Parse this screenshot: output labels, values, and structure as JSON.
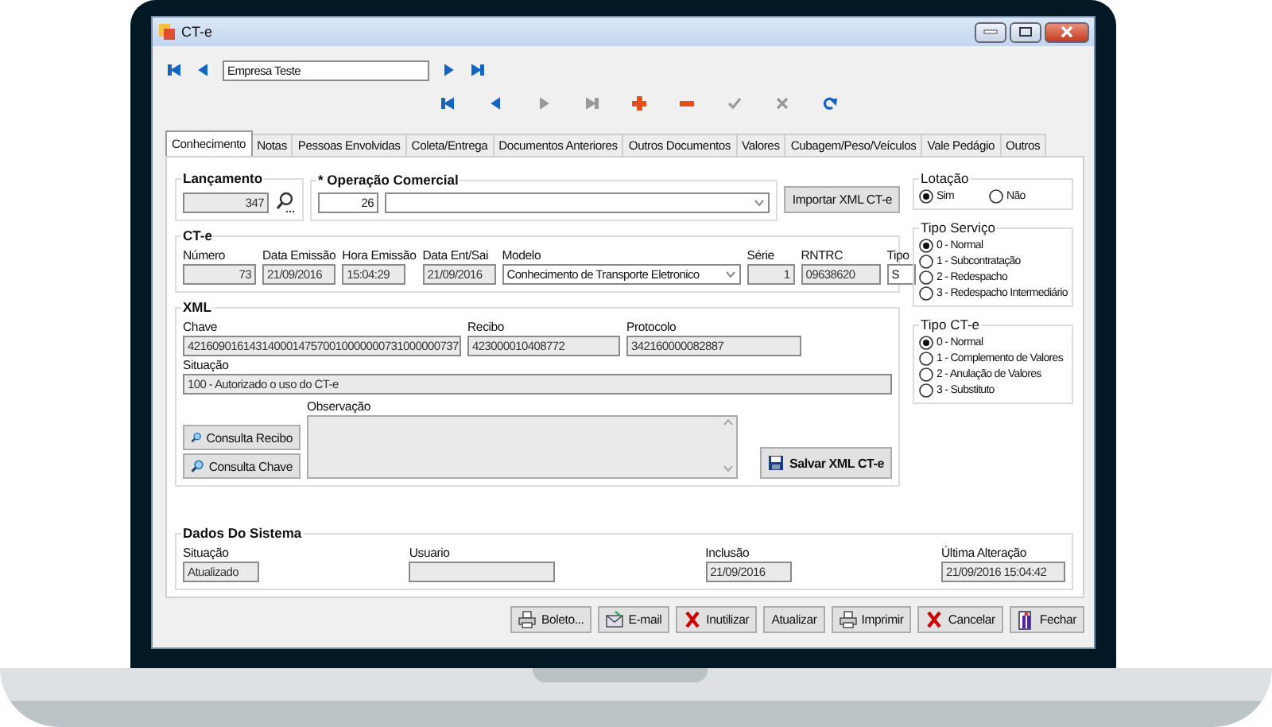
{
  "window": {
    "title": "CT-e"
  },
  "record_nav": {
    "buttons": [
      {
        "kind": "first",
        "disabled": false
      },
      {
        "kind": "prev",
        "disabled": false
      }
    ],
    "value": "Empresa Teste",
    "after": [
      {
        "kind": "next",
        "disabled": false
      },
      {
        "kind": "last",
        "disabled": false
      }
    ]
  },
  "toolbar": [
    {
      "kind": "first",
      "disabled": false
    },
    {
      "kind": "prev",
      "disabled": false
    },
    {
      "kind": "next",
      "disabled": true
    },
    {
      "kind": "last",
      "disabled": true
    },
    {
      "kind": "add",
      "disabled": false
    },
    {
      "kind": "remove",
      "disabled": false
    },
    {
      "kind": "confirm",
      "disabled": true
    },
    {
      "kind": "cancel",
      "disabled": true
    },
    {
      "kind": "refresh",
      "disabled": false
    }
  ],
  "tabs": [
    {
      "label": "Conhecimento",
      "selected": true
    },
    {
      "label": "Notas",
      "selected": false
    },
    {
      "label": "Pessoas Envolvidas",
      "selected": false
    },
    {
      "label": "Coleta/Entrega",
      "selected": false
    },
    {
      "label": "Documentos Anteriores",
      "selected": false
    },
    {
      "label": "Outros Documentos",
      "selected": false
    },
    {
      "label": "Valores",
      "selected": false
    },
    {
      "label": "Cubagem/Peso/Veículos",
      "selected": false
    },
    {
      "label": "Vale Pedágio",
      "selected": false
    },
    {
      "label": "Outros",
      "selected": false
    }
  ],
  "lancamento": {
    "title": "Lançamento",
    "value": "347",
    "disabled": true
  },
  "operacao": {
    "title": "* Operação Comercial",
    "code": "26"
  },
  "import_button": "Importar XML CT-e",
  "cte": {
    "title": "CT-e",
    "fields": [
      {
        "label": "Número",
        "value": "73",
        "kind": "number",
        "disabled": true
      },
      {
        "label": "Data Emissão",
        "value": "21/09/2016",
        "kind": "text",
        "disabled": true
      },
      {
        "label": "Hora Emissão",
        "value": "15:04:29",
        "kind": "text",
        "disabled": true
      },
      {
        "label": "Data Ent/Sai",
        "value": "21/09/2016",
        "kind": "text",
        "disabled": true
      },
      {
        "label": "Modelo",
        "value": "Conhecimento de Transporte Eletronico",
        "kind": "select",
        "disabled": false
      },
      {
        "label": "Série",
        "value": "1",
        "kind": "number",
        "disabled": true
      },
      {
        "label": "RNTRC",
        "value": "09638620",
        "kind": "text",
        "disabled": true
      },
      {
        "label": "Tipo",
        "value": "S",
        "kind": "text",
        "disabled": false
      }
    ]
  },
  "xml": {
    "title": "XML",
    "fields": [
      {
        "label": "Chave",
        "value": "42160901614314000147570010000000731000000737"
      },
      {
        "label": "Recibo",
        "value": "423000010408772"
      },
      {
        "label": "Protocolo",
        "value": "342160000082887"
      }
    ],
    "situacao_label": "Situação",
    "situacao": "100 - Autorizado o uso do CT-e",
    "buttons": [
      "Consulta Recibo",
      "Consulta Chave"
    ],
    "observacao_label": "Observação",
    "save_button": "Salvar XML CT-e"
  },
  "radio_groups": [
    {
      "title": "Lotação",
      "options": [
        {
          "label": "Sim",
          "selected": true
        },
        {
          "label": "Não",
          "selected": false
        }
      ]
    },
    {
      "title": "Tipo Serviço",
      "options": [
        {
          "label": "0 - Normal",
          "selected": true
        },
        {
          "label": "1 - Subcontratação",
          "selected": false
        },
        {
          "label": "2 - Redespacho",
          "selected": false
        },
        {
          "label": "3 - Redespacho Intermediário",
          "selected": false
        }
      ]
    },
    {
      "title": "Tipo CT-e",
      "options": [
        {
          "label": "0 - Normal",
          "selected": true
        },
        {
          "label": "1 - Complemento de Valores",
          "selected": false
        },
        {
          "label": "2 - Anulação de Valores",
          "selected": false
        },
        {
          "label": "3 - Substituto",
          "selected": false
        }
      ]
    }
  ],
  "sistema": {
    "title": "Dados Do Sistema",
    "fields": [
      {
        "label": "Situação",
        "value": "Atualizado"
      },
      {
        "label": "Usuario"
      },
      {
        "label": "Inclusão",
        "value": "21/09/2016"
      },
      {
        "label": "Última Alteração",
        "value": "21/09/2016 15:04:42"
      }
    ]
  },
  "buttons": [
    {
      "label": "Boleto...",
      "kind": "print"
    },
    {
      "label": "E-mail",
      "kind": "mail"
    },
    {
      "label": "Inutilizar",
      "kind": "cross"
    },
    {
      "label": "Atualizar",
      "kind": "plain"
    },
    {
      "label": "Imprimir",
      "kind": "print"
    },
    {
      "label": "Cancelar",
      "kind": "cross"
    },
    {
      "label": "Fechar",
      "kind": "exit"
    }
  ]
}
